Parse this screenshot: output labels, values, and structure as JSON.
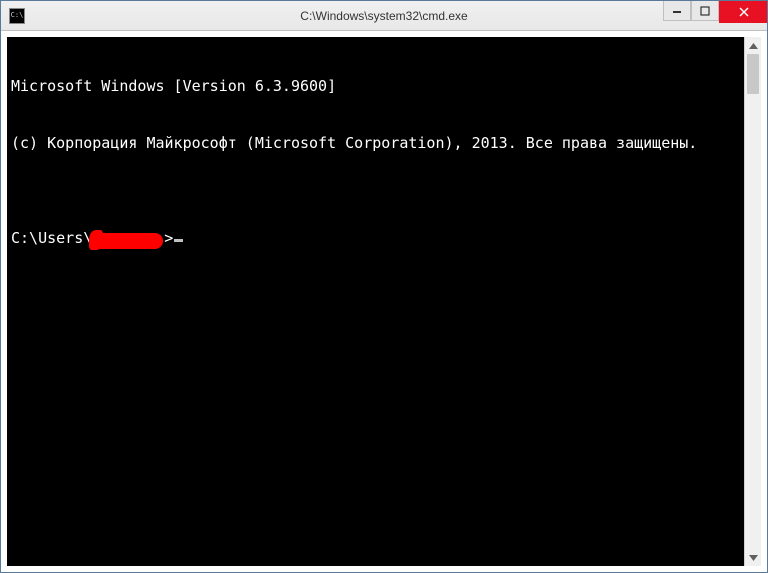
{
  "window": {
    "title": "C:\\Windows\\system32\\cmd.exe",
    "icon_text": "C:\\"
  },
  "controls": {
    "minimize_glyph": "—",
    "close_glyph": "✕"
  },
  "console": {
    "line1": "Microsoft Windows [Version 6.3.9600]",
    "line2": "(c) Корпорация Майкрософт (Microsoft Corporation), 2013. Все права защищены.",
    "blank": "",
    "prompt_prefix": "C:\\Users\\",
    "prompt_suffix": ">"
  }
}
